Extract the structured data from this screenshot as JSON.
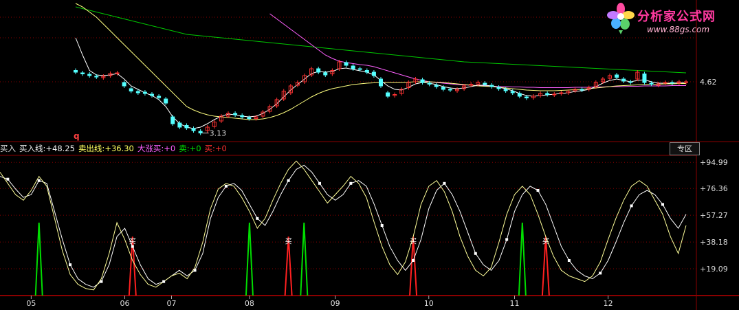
{
  "brand": {
    "name": "分析家公式网",
    "url": "www.88gs.com"
  },
  "upper_panel": {
    "price_label": "4.62",
    "low_annotation": "3.13",
    "marker_q": "q"
  },
  "indicator_header": {
    "prefix": "买入",
    "buy_line_label": "买入线:",
    "buy_line_value": "+48.25",
    "sell_line_label": "卖出线:",
    "sell_line_value": "+36.30",
    "big_rise_label": "大涨买:",
    "big_rise_value": "+0",
    "sell_label": "卖:",
    "sell_value": "+0",
    "buy_label": "买:",
    "buy_value": "+0",
    "zone_button": "专区"
  },
  "colors": {
    "bg": "#000000",
    "up": "#ff3232",
    "down": "#54ffff",
    "frame": "#8b0000",
    "sell_spike": "#00dd00",
    "buy_spike": "#ff2020",
    "ma_long": "#00c800",
    "ma_mid": "#ff60ff",
    "ma_yellow": "#ffff80"
  },
  "buy_marker": "买",
  "chart_data": [
    {
      "type": "line",
      "panel": "price",
      "price_ticks": [
        "4.62"
      ],
      "annotations": [
        "3.13"
      ],
      "candles": [
        [
          4.95,
          4.9
        ],
        [
          4.88,
          4.85
        ],
        [
          4.84,
          4.8
        ],
        [
          4.78,
          4.76
        ],
        [
          4.74,
          4.78
        ],
        [
          4.8,
          4.86
        ],
        [
          4.86,
          4.88
        ],
        [
          4.6,
          4.5
        ],
        [
          4.42,
          4.35
        ],
        [
          4.34,
          4.3
        ],
        [
          4.32,
          4.28
        ],
        [
          4.26,
          4.22
        ],
        [
          4.2,
          4.16
        ],
        [
          4.12,
          4.0
        ],
        [
          3.6,
          3.4
        ],
        [
          3.42,
          3.3
        ],
        [
          3.35,
          3.28
        ],
        [
          3.26,
          3.2
        ],
        [
          3.18,
          3.13
        ],
        [
          3.2,
          3.3
        ],
        [
          3.32,
          3.45
        ],
        [
          3.48,
          3.62
        ],
        [
          3.62,
          3.7
        ],
        [
          3.7,
          3.66
        ],
        [
          3.64,
          3.6
        ],
        [
          3.58,
          3.55
        ],
        [
          3.55,
          3.6
        ],
        [
          3.62,
          3.74
        ],
        [
          3.76,
          3.9
        ],
        [
          3.92,
          4.1
        ],
        [
          4.12,
          4.35
        ],
        [
          4.3,
          4.5
        ],
        [
          4.52,
          4.6
        ],
        [
          4.62,
          4.8
        ],
        [
          4.82,
          5.0
        ],
        [
          5.0,
          4.9
        ],
        [
          4.88,
          4.82
        ],
        [
          4.85,
          4.95
        ],
        [
          5.0,
          5.2
        ],
        [
          5.18,
          5.1
        ],
        [
          5.08,
          5.0
        ],
        [
          5.0,
          4.98
        ],
        [
          4.95,
          4.9
        ],
        [
          4.9,
          4.8
        ],
        [
          4.7,
          4.5
        ],
        [
          4.3,
          4.2
        ],
        [
          4.22,
          4.25
        ],
        [
          4.28,
          4.4
        ],
        [
          4.45,
          4.6
        ],
        [
          4.62,
          4.7
        ],
        [
          4.68,
          4.6
        ],
        [
          4.58,
          4.55
        ],
        [
          4.52,
          4.48
        ],
        [
          4.46,
          4.4
        ],
        [
          4.4,
          4.38
        ],
        [
          4.36,
          4.4
        ],
        [
          4.42,
          4.5
        ],
        [
          4.52,
          4.55
        ],
        [
          4.55,
          4.6
        ],
        [
          4.58,
          4.54
        ],
        [
          4.52,
          4.48
        ],
        [
          4.46,
          4.42
        ],
        [
          4.4,
          4.36
        ],
        [
          4.34,
          4.3
        ],
        [
          4.28,
          4.2
        ],
        [
          4.18,
          4.15
        ],
        [
          4.16,
          4.2
        ],
        [
          4.22,
          4.28
        ],
        [
          4.28,
          4.25
        ],
        [
          4.24,
          4.26
        ],
        [
          4.28,
          4.3
        ],
        [
          4.3,
          4.34
        ],
        [
          4.36,
          4.4
        ],
        [
          4.4,
          4.38
        ],
        [
          4.4,
          4.45
        ],
        [
          4.48,
          4.6
        ],
        [
          4.62,
          4.7
        ],
        [
          4.72,
          4.8
        ],
        [
          4.82,
          4.75
        ],
        [
          4.7,
          4.64
        ],
        [
          4.62,
          4.6
        ],
        [
          4.7,
          4.9
        ],
        [
          4.85,
          4.6
        ],
        [
          4.58,
          4.55
        ],
        [
          4.52,
          4.56
        ],
        [
          4.58,
          4.6
        ],
        [
          4.6,
          4.58
        ],
        [
          4.58,
          4.62
        ],
        [
          4.6,
          4.62
        ]
      ],
      "series": [
        {
          "values": [
            6.8,
            6.75,
            6.7,
            6.65,
            6.6,
            6.55,
            6.5,
            6.45,
            6.4,
            6.35,
            6.3,
            6.25,
            6.2,
            6.15,
            6.1,
            6.05,
            6.0,
            5.98,
            5.96,
            5.94,
            5.92,
            5.9,
            5.88,
            5.86,
            5.84,
            5.82,
            5.8,
            5.78,
            5.76,
            5.74,
            5.72,
            5.7,
            5.68,
            5.66,
            5.64,
            5.62,
            5.6,
            5.58,
            5.56,
            5.54,
            5.52,
            5.5,
            5.48,
            5.46,
            5.44,
            5.42,
            5.4,
            5.38,
            5.36,
            5.34,
            5.32,
            5.3,
            5.28,
            5.26,
            5.24,
            5.22,
            5.2,
            5.19,
            5.18,
            5.17,
            5.16,
            5.15,
            5.14,
            5.13,
            5.12,
            5.11,
            5.1,
            5.09,
            5.08,
            5.07,
            5.06,
            5.05,
            5.04,
            5.03,
            5.02,
            5.01,
            5.0,
            4.99,
            4.98,
            4.97,
            4.96,
            4.95,
            4.94,
            4.93,
            4.92,
            4.91,
            4.9,
            4.89,
            4.88
          ]
        },
        {
          "values": [
            null,
            null,
            null,
            null,
            null,
            null,
            null,
            null,
            null,
            null,
            null,
            null,
            null,
            null,
            null,
            null,
            null,
            null,
            null,
            null,
            null,
            null,
            null,
            null,
            null,
            null,
            null,
            null,
            6.6,
            6.45,
            6.3,
            6.15,
            6.0,
            5.85,
            5.7,
            5.55,
            5.4,
            5.3,
            5.22,
            5.18,
            5.15,
            5.12,
            5.1,
            5.06,
            5.0,
            4.94,
            4.88,
            4.82,
            4.76,
            4.7,
            4.66,
            4.62,
            4.6,
            4.58,
            4.56,
            4.54,
            4.53,
            4.52,
            4.51,
            4.5,
            4.49,
            4.48,
            4.48,
            4.47,
            4.47,
            4.46,
            4.46,
            4.45,
            4.45,
            4.45,
            4.45,
            4.45,
            4.46,
            4.46,
            4.46,
            4.47,
            4.47,
            4.48,
            4.48,
            4.48,
            4.49,
            4.49,
            4.5,
            4.5,
            4.5,
            4.5,
            4.51,
            4.51,
            4.51
          ]
        },
        {
          "values": [
            6.9,
            6.8,
            6.65,
            6.5,
            6.3,
            6.1,
            5.9,
            5.7,
            5.5,
            5.3,
            5.1,
            4.9,
            4.7,
            4.5,
            4.3,
            4.1,
            3.9,
            3.8,
            3.72,
            3.66,
            3.62,
            3.6,
            3.58,
            3.56,
            3.54,
            3.52,
            3.52,
            3.54,
            3.58,
            3.64,
            3.72,
            3.82,
            3.94,
            4.06,
            4.18,
            4.28,
            4.36,
            4.42,
            4.46,
            4.5,
            4.54,
            4.56,
            4.58,
            4.59,
            4.6,
            4.6,
            4.6,
            4.6,
            4.61,
            4.62,
            4.62,
            4.62,
            4.61,
            4.6,
            4.58,
            4.56,
            4.54,
            4.52,
            4.5,
            4.49,
            4.48,
            4.46,
            4.44,
            4.42,
            4.4,
            4.38,
            4.37,
            4.36,
            4.36,
            4.36,
            4.37,
            4.38,
            4.39,
            4.4,
            4.42,
            4.44,
            4.46,
            4.48,
            4.5,
            4.51,
            4.52,
            4.53,
            4.54,
            4.55,
            4.55,
            4.56,
            4.56,
            4.57,
            4.57
          ]
        },
        {
          "values": [
            5.9,
            5.4,
            4.95,
            4.82,
            4.8,
            4.82,
            4.86,
            4.7,
            4.5,
            4.4,
            4.3,
            4.22,
            4.1,
            3.9,
            3.6,
            3.4,
            3.3,
            3.26,
            3.3,
            3.4,
            3.52,
            3.62,
            3.68,
            3.66,
            3.62,
            3.6,
            3.62,
            3.7,
            3.82,
            3.98,
            4.18,
            4.38,
            4.54,
            4.7,
            4.86,
            4.92,
            4.9,
            4.92,
            5.0,
            5.02,
            4.98,
            4.94,
            4.9,
            4.82,
            4.66,
            4.5,
            4.4,
            4.38,
            4.46,
            4.56,
            4.6,
            4.58,
            4.54,
            4.48,
            4.44,
            4.42,
            4.44,
            4.48,
            4.52,
            4.52,
            4.5,
            4.46,
            4.42,
            4.36,
            4.28,
            4.22,
            4.2,
            4.22,
            4.24,
            4.26,
            4.28,
            4.3,
            4.34,
            4.36,
            4.4,
            4.48,
            4.58,
            4.66,
            4.7,
            4.66,
            4.62,
            4.66,
            4.68,
            4.62,
            4.58,
            4.58,
            4.58,
            4.59,
            4.6
          ]
        }
      ]
    },
    {
      "type": "line",
      "panel": "indicator",
      "title": "",
      "y_ticks": [
        94.99,
        76.36,
        57.27,
        38.18,
        19.09
      ],
      "ylim": [
        0,
        100
      ],
      "x_ticks": [
        "05",
        "06",
        "07",
        "08",
        "09",
        "10",
        "11",
        "12"
      ],
      "series": [
        {
          "values": [
            85,
            83,
            76,
            70,
            72,
            82,
            80,
            60,
            40,
            22,
            12,
            8,
            6,
            10,
            22,
            42,
            48,
            35,
            22,
            12,
            8,
            10,
            14,
            18,
            14,
            18,
            30,
            55,
            70,
            78,
            80,
            75,
            65,
            55,
            50,
            60,
            72,
            82,
            90,
            93,
            88,
            80,
            72,
            68,
            72,
            80,
            82,
            78,
            65,
            50,
            35,
            25,
            18,
            25,
            40,
            62,
            75,
            80,
            72,
            60,
            45,
            30,
            22,
            18,
            25,
            40,
            60,
            72,
            78,
            75,
            65,
            50,
            35,
            25,
            18,
            14,
            12,
            16,
            25,
            38,
            52,
            64,
            72,
            75,
            72,
            65,
            55,
            48,
            58
          ]
        },
        {
          "values": [
            88,
            80,
            72,
            68,
            75,
            85,
            78,
            55,
            32,
            15,
            8,
            5,
            4,
            12,
            30,
            52,
            40,
            25,
            15,
            8,
            6,
            10,
            14,
            16,
            12,
            20,
            38,
            62,
            76,
            80,
            78,
            70,
            60,
            48,
            55,
            68,
            80,
            90,
            96,
            90,
            82,
            74,
            66,
            72,
            78,
            85,
            80,
            70,
            52,
            35,
            22,
            15,
            24,
            42,
            65,
            78,
            82,
            74,
            60,
            42,
            28,
            18,
            14,
            20,
            38,
            58,
            72,
            78,
            72,
            58,
            42,
            28,
            18,
            14,
            12,
            10,
            14,
            24,
            40,
            55,
            68,
            78,
            82,
            78,
            68,
            58,
            42,
            30,
            50
          ]
        }
      ],
      "signals": [
        {
          "kind": "sell",
          "index": 5,
          "value": 38
        },
        {
          "kind": "buy",
          "index": 17,
          "value": 30,
          "label": "买"
        },
        {
          "kind": "sell",
          "index": 32,
          "value": 38
        },
        {
          "kind": "buy",
          "index": 37,
          "value": 30,
          "label": "买"
        },
        {
          "kind": "sell",
          "index": 39,
          "value": 38
        },
        {
          "kind": "buy",
          "index": 53,
          "value": 30,
          "label": "买"
        },
        {
          "kind": "sell",
          "index": 67,
          "value": 38
        },
        {
          "kind": "buy",
          "index": 70,
          "value": 30,
          "label": "买"
        }
      ]
    }
  ]
}
